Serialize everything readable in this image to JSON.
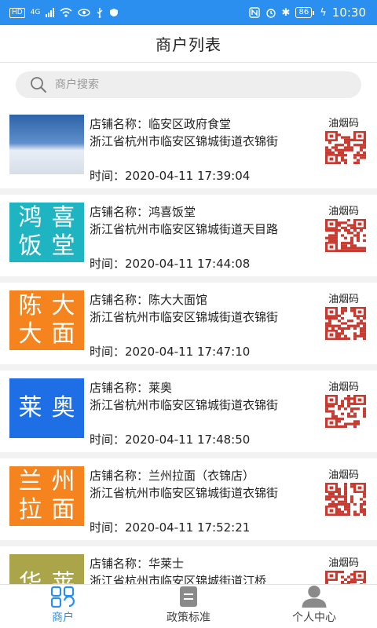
{
  "status_bar": {
    "hd": "HD",
    "network": "4G",
    "battery": "86",
    "time": "10:30",
    "icons": [
      "hd-icon",
      "signal-icon",
      "wifi-icon",
      "eye-comfort-icon",
      "usb-icon",
      "shield-icon",
      "nfc-icon",
      "alarm-icon",
      "bluetooth-icon",
      "battery-icon",
      "charging-icon"
    ]
  },
  "header": {
    "title": "商户列表"
  },
  "search": {
    "placeholder": "商户搜索",
    "value": "",
    "icon": "search-icon"
  },
  "merchants": [
    {
      "name_line": "店铺名称：临安区政府食堂",
      "address": "浙江省杭州市临安区锦城街道衣锦街",
      "time_line": "时间：2020-04-11 17:39:04",
      "code_label": "油烟码",
      "thumb": {
        "kind": "photo",
        "chars": [],
        "color": ""
      }
    },
    {
      "name_line": "店铺名称：鸿喜饭堂",
      "address": "浙江省杭州市临安区锦城街道天目路",
      "time_line": "时间：2020-04-11 17:44:08",
      "code_label": "油烟码",
      "thumb": {
        "kind": "text",
        "chars": [
          "鸿",
          "喜",
          "饭",
          "堂"
        ],
        "color": "#1fb4c2"
      }
    },
    {
      "name_line": "店铺名称：陈大大面馆",
      "address": "浙江省杭州市临安区锦城街道衣锦街",
      "time_line": "时间：2020-04-11 17:47:10",
      "code_label": "油烟码",
      "thumb": {
        "kind": "text",
        "chars": [
          "陈",
          "大",
          "大",
          "面"
        ],
        "color": "#f5841f"
      }
    },
    {
      "name_line": "店铺名称：莱奥",
      "address": "浙江省杭州市临安区锦城街道衣锦街",
      "time_line": "时间：2020-04-11 17:48:50",
      "code_label": "油烟码",
      "thumb": {
        "kind": "text",
        "chars": [
          "莱",
          "奥"
        ],
        "color": "#1e6fe6"
      }
    },
    {
      "name_line": "店铺名称：兰州拉面（衣锦店）",
      "address": "浙江省杭州市临安区锦城街道衣锦街",
      "time_line": "时间：2020-04-11 17:52:21",
      "code_label": "油烟码",
      "thumb": {
        "kind": "text",
        "chars": [
          "兰",
          "州",
          "拉",
          "面"
        ],
        "color": "#f5841f"
      }
    },
    {
      "name_line": "店铺名称：华莱士",
      "address": "浙江省杭州市临安区锦城街道汀桥",
      "time_line": "",
      "code_label": "油烟码",
      "thumb": {
        "kind": "text",
        "chars": [
          "华",
          "莱"
        ],
        "color": "#a9a548"
      }
    }
  ],
  "tabs": [
    {
      "label": "商户",
      "icon": "merchant-grid-icon",
      "active": true
    },
    {
      "label": "政策标准",
      "icon": "policy-document-icon",
      "active": false
    },
    {
      "label": "个人中心",
      "icon": "user-profile-icon",
      "active": false
    }
  ],
  "colors": {
    "accent": "#2b8ff0",
    "tab_inactive": "#444444",
    "background": "#f2f2f2"
  }
}
